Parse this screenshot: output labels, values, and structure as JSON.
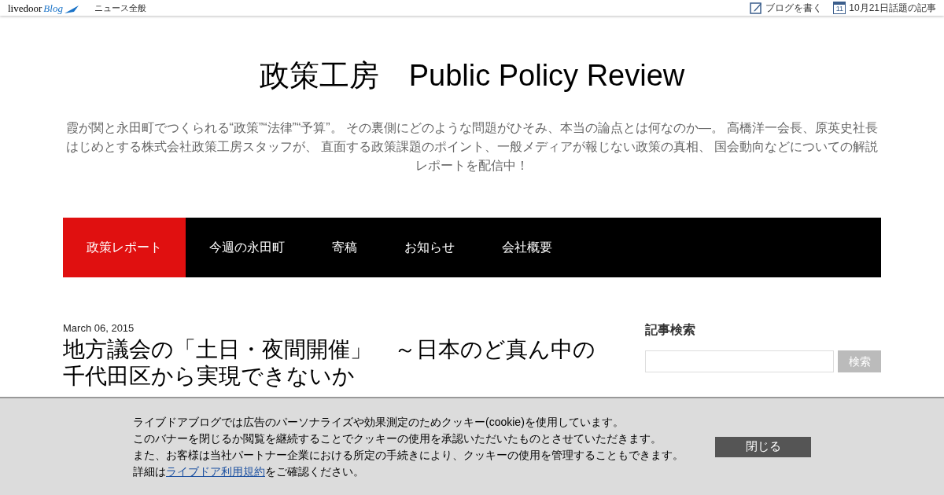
{
  "topbar": {
    "logo_text": "livedoor",
    "logo_mark": "Blog",
    "news_link": "ニュース全般",
    "write_link": "ブログを書く",
    "calendar_day": "11",
    "topics_link": "10月21日話題の記事"
  },
  "blog": {
    "title": "政策工房　Public Policy Review",
    "description": "霞が関と永田町でつくられる“政策”“法律”“予算”。 その裏側にどのような問題がひそみ、本当の論点とは何なのか―。 高橋洋一会長、原英史社長はじめとする株式会社政策工房スタッフが、 直面する政策課題のポイント、一般メディアが報じない政策の真相、 国会動向などについての解説レポートを配信中！"
  },
  "nav": [
    {
      "label": "政策レポート",
      "selected": true
    },
    {
      "label": "今週の永田町",
      "selected": false
    },
    {
      "label": "寄稿",
      "selected": false
    },
    {
      "label": "お知らせ",
      "selected": false
    },
    {
      "label": "会社概要",
      "selected": false
    }
  ],
  "article": {
    "date": "March 06, 2015",
    "title": "地方議会の「土日・夜間開催」　～日本のど真ん中の千代田区から実現できないか"
  },
  "sidebar": {
    "heading": "記事検索",
    "search_button": "検索"
  },
  "cookie_banner": {
    "lines": [
      "ライブドアブログでは広告のパーソナライズや効果測定のためクッキー(cookie)を使用しています。",
      "このバナーを閉じるか閲覧を継続することでクッキーの使用を承認いただいたものとさせていただきます。",
      "また、お客様は当社パートナー企業における所定の手続きにより、クッキーの使用を管理することもできます。"
    ],
    "last_prefix": "詳細は",
    "link": "ライブドア利用規約",
    "last_suffix": "をご確認ください。",
    "close_button": "閉じる"
  }
}
